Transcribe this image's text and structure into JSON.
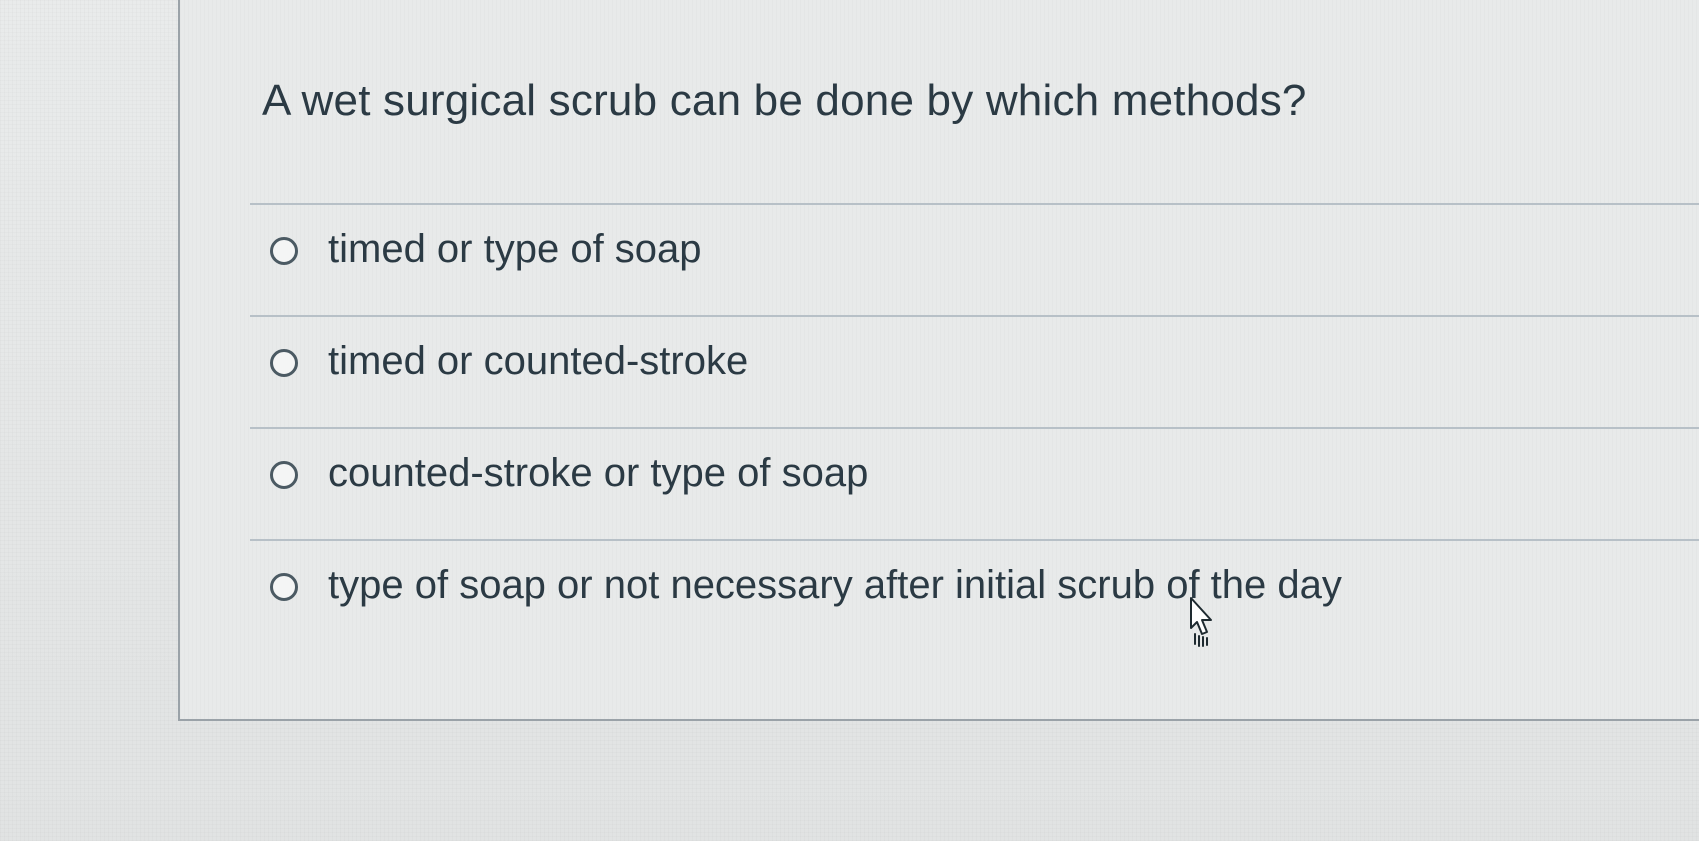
{
  "question": {
    "text": "A wet surgical scrub can be done by which methods?"
  },
  "answers": [
    {
      "label": "timed or type of soap",
      "selected": false
    },
    {
      "label": "timed or counted-stroke",
      "selected": false
    },
    {
      "label": "counted-stroke or type of soap",
      "selected": false
    },
    {
      "label": "type of soap or not necessary after initial scrub of the day",
      "selected": false
    }
  ],
  "cursor": {
    "icon": "hand-pointer-cursor-icon"
  }
}
